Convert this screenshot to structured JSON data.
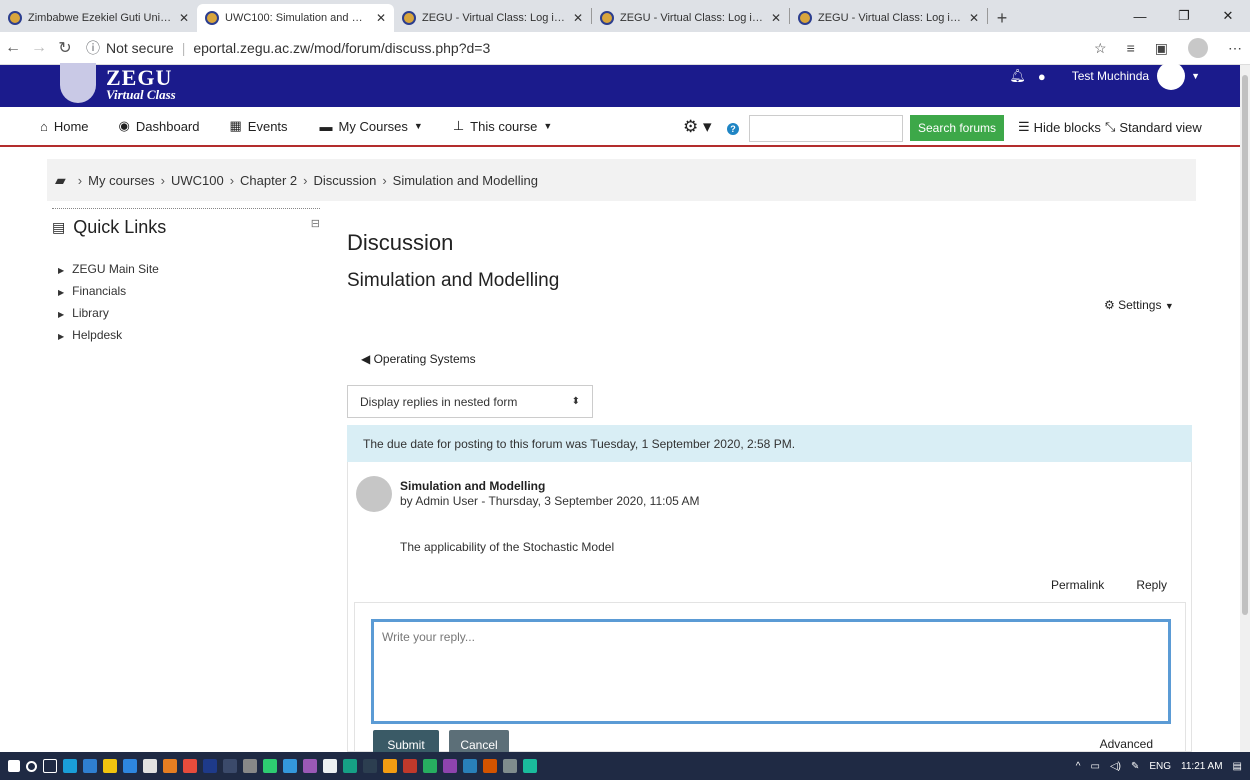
{
  "browser": {
    "tabs": [
      {
        "title": "Zimbabwe Ezekiel Guti University",
        "active": false
      },
      {
        "title": "UWC100: Simulation and Modelling",
        "active": true
      },
      {
        "title": "ZEGU - Virtual Class: Log in to the site",
        "active": false
      },
      {
        "title": "ZEGU - Virtual Class: Log in to the site",
        "active": false
      },
      {
        "title": "ZEGU - Virtual Class: Log in to the site",
        "active": false
      }
    ],
    "security": "Not secure",
    "url": "eportal.zegu.ac.zw/mod/forum/discuss.php?d=3"
  },
  "header": {
    "logo_big": "ZEGU",
    "logo_small": "Virtual Class",
    "user_name": "Test Muchinda"
  },
  "nav": {
    "home": "Home",
    "dashboard": "Dashboard",
    "events": "Events",
    "my_courses": "My Courses",
    "this_course": "This course",
    "search_button": "Search forums",
    "hide_blocks": "Hide blocks",
    "standard_view": "Standard view"
  },
  "breadcrumb": [
    "My courses",
    "UWC100",
    "Chapter 2",
    "Discussion",
    "Simulation and Modelling"
  ],
  "quick_links": {
    "title": "Quick Links",
    "items": [
      "ZEGU Main Site",
      "Financials",
      "Library",
      "Helpdesk"
    ]
  },
  "main": {
    "title": "Discussion",
    "subtitle": "Simulation and Modelling",
    "settings": "Settings",
    "prev_link": "Operating Systems",
    "display_mode": "Display replies in nested form",
    "notice": "The due date for posting to this forum was Tuesday, 1 September 2020, 2:58 PM.",
    "post": {
      "title": "Simulation and Modelling",
      "byline": "by Admin User - Thursday, 3 September 2020, 11:05 AM",
      "body": "The applicability of the Stochastic Model",
      "permalink": "Permalink",
      "reply": "Reply"
    },
    "reply_form": {
      "placeholder": "Write your reply...",
      "submit": "Submit",
      "cancel": "Cancel",
      "advanced": "Advanced"
    }
  },
  "taskbar": {
    "lang": "ENG",
    "time": "11:21 AM"
  }
}
